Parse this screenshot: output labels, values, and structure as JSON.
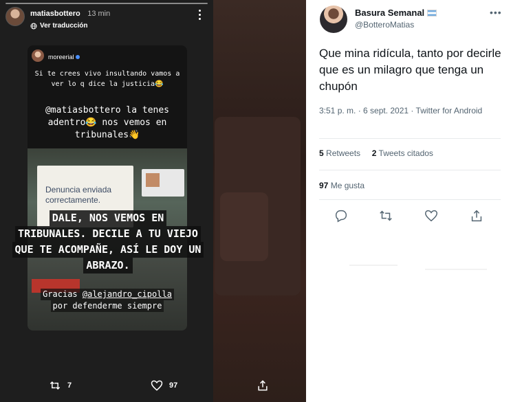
{
  "story": {
    "username": "matiasbottero",
    "time": "13 min",
    "translate_label": "Ver traducción",
    "inner_username": "moreerial",
    "inner_message_1": "Si te crees vivo insultando vamos a ver lo q dice la justicia😂",
    "inner_message_2": "@matiasbottero la tenes adentro😂 nos vemos en tribunales👋",
    "doc_text": "Denuncia enviada correctamente.",
    "overlay_lines": [
      "DALE, NOS VEMOS EN",
      "TRIBUNALES. DECILE A TU VIEJO",
      "QUE TE ACOMPAÑE, ASÍ LE DOY UN",
      "ABRAZO."
    ],
    "thanks_prefix": "Gracias ",
    "thanks_mention": "@alejandro_cipolla",
    "thanks_line_2": "por defenderme siempre",
    "footer": {
      "reposts": "7",
      "likes": "97"
    },
    "icons": {
      "globe": "globe-icon",
      "more": "more-vertical-icon",
      "next": "double-chevron-right-icon",
      "repost": "repost-icon",
      "heart": "heart-icon",
      "share": "share-icon"
    }
  },
  "tweet": {
    "name": "Basura Semanal",
    "handle": "@BotteroMatias",
    "text": "Que mina ridícula, tanto por decirle que es un milagro que tenga un chupón",
    "date_line": "3:51 p. m. · 6 sept. 2021 · Twitter for Android",
    "retweets_count": "5",
    "retweets_label": "Retweets",
    "quotes_count": "2",
    "quotes_label": "Tweets citados",
    "likes_count": "97",
    "likes_label": "Me gusta",
    "icons": {
      "reply": "reply-icon",
      "retweet": "retweet-icon",
      "like": "heart-icon",
      "share": "share-icon",
      "more": "more-horizontal-icon",
      "flag": "argentina-flag-icon"
    }
  },
  "colors": {
    "story_bg": "#1e1e1e",
    "twitter_text": "#0f1419",
    "twitter_muted": "#536471"
  }
}
